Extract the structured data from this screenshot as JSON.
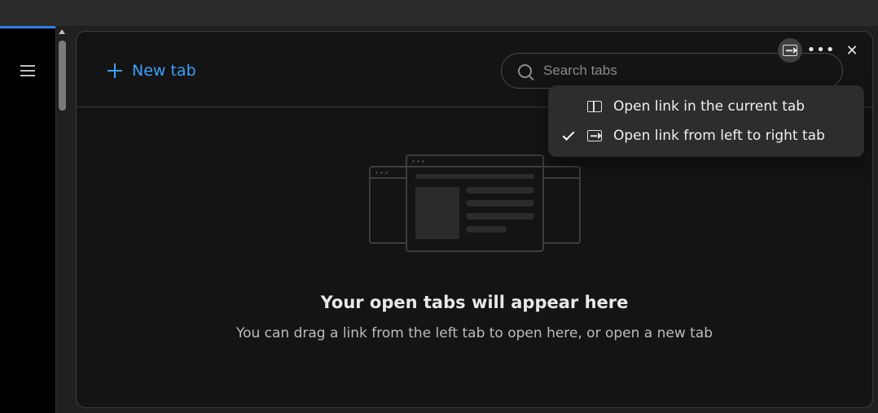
{
  "colors": {
    "accent": "#2f7ee3",
    "link": "#3ba0ff"
  },
  "header": {
    "new_tab_label": "New tab",
    "search_placeholder": "Search tabs"
  },
  "empty_state": {
    "title": "Your open tabs will appear here",
    "subtitle": "You can drag a link from the left tab to open here, or open a new tab"
  },
  "menu": {
    "items": [
      {
        "label": "Open link in the current tab",
        "checked": false
      },
      {
        "label": "Open link from left to right tab",
        "checked": true
      }
    ]
  },
  "icons": {
    "hamburger": "hamburger-icon",
    "search": "search-icon",
    "split_layout": "split-layout-icon",
    "more": "more-icon",
    "close": "close-icon",
    "check": "check-icon"
  }
}
